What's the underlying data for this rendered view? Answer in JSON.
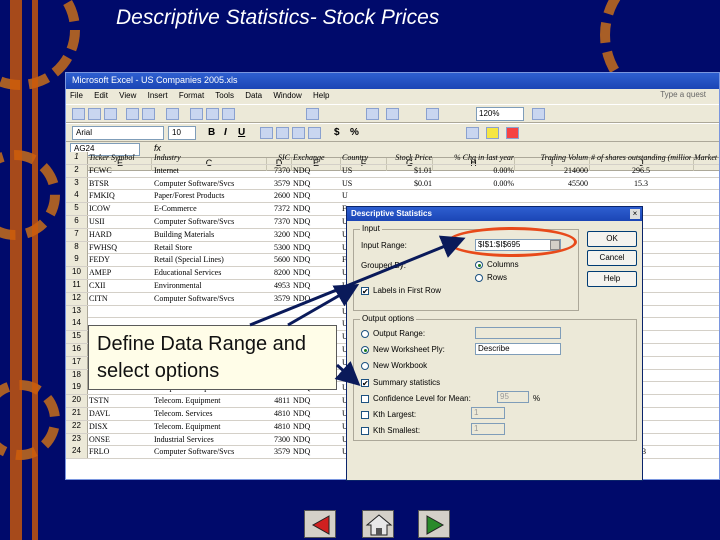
{
  "slide": {
    "title": "Descriptive Statistics- Stock Prices",
    "callout": "Define Data Range and select options"
  },
  "excel": {
    "window_title": "Microsoft Excel - US Companies 2005.xls",
    "menu": [
      "File",
      "Edit",
      "View",
      "Insert",
      "Format",
      "Tools",
      "Data",
      "Window",
      "Help"
    ],
    "help_placeholder": "Type a quest",
    "zoom": "120%",
    "font": "Arial",
    "font_size": "10",
    "name_box": "AG24",
    "fx": "fx",
    "col_headers": [
      "E",
      "C",
      "D",
      "E",
      "F",
      "G",
      "H",
      "I",
      "J"
    ],
    "header_row": {
      "rn": "1",
      "e": "Ticker Symbol",
      "c": "Industry",
      "d": "SIC",
      "e2": "Exchange",
      "f": "Country",
      "g": "Stock Price",
      "h": "% Chg in last year",
      "i": "Trading Volum",
      "j": "# of shares outstanding (millions)",
      "k": "Market"
    },
    "rows": [
      {
        "rn": "2",
        "e": "FCWC",
        "c": "Internet",
        "d": "7370",
        "e2": "NDQ",
        "f": "US",
        "g": "$1.01",
        "h": "0.00%",
        "i": "214000",
        "j": "296.5"
      },
      {
        "rn": "3",
        "e": "BTSR",
        "c": "Computer Software/Svcs",
        "d": "3579",
        "e2": "NDQ",
        "f": "US",
        "g": "$0.01",
        "h": "0.00%",
        "i": "45500",
        "j": "15.3"
      },
      {
        "rn": "4",
        "e": "FMKIQ",
        "c": "Paper/Forest Products",
        "d": "2600",
        "e2": "NDQ",
        "f": "U",
        "g": "",
        "h": "",
        "i": "",
        "j": ""
      },
      {
        "rn": "5",
        "e": "ICOW",
        "c": "E-Commerce",
        "d": "7372",
        "e2": "NDQ",
        "f": "F",
        "g": "",
        "h": "",
        "i": "",
        "j": ""
      },
      {
        "rn": "6",
        "e": "USII",
        "c": "Computer Software/Svcs",
        "d": "7370",
        "e2": "NDQ",
        "f": "U",
        "g": "",
        "h": "",
        "i": "",
        "j": ""
      },
      {
        "rn": "7",
        "e": "HARD",
        "c": "Building Materials",
        "d": "3200",
        "e2": "NDQ",
        "f": "U",
        "g": "",
        "h": "",
        "i": "",
        "j": ""
      },
      {
        "rn": "8",
        "e": "FWHSQ",
        "c": "Retail Store",
        "d": "5300",
        "e2": "NDQ",
        "f": "U",
        "g": "",
        "h": "",
        "i": "",
        "j": ""
      },
      {
        "rn": "9",
        "e": "FEDY",
        "c": "Retail (Special Lines)",
        "d": "5600",
        "e2": "NDQ",
        "f": "F",
        "g": "",
        "h": "",
        "i": "",
        "j": ""
      },
      {
        "rn": "10",
        "e": "AMEP",
        "c": "Educational Services",
        "d": "8200",
        "e2": "NDQ",
        "f": "U",
        "g": "",
        "h": "",
        "i": "",
        "j": ""
      },
      {
        "rn": "11",
        "e": "CXII",
        "c": "Environmental",
        "d": "4953",
        "e2": "NDQ",
        "f": "U",
        "g": "",
        "h": "",
        "i": "",
        "j": ""
      },
      {
        "rn": "12",
        "e": "CITN",
        "c": "Computer Software/Svcs",
        "d": "3579",
        "e2": "NDQ",
        "f": "U",
        "g": "",
        "h": "",
        "i": "",
        "j": ""
      },
      {
        "rn": "13",
        "e": "",
        "c": "",
        "d": "",
        "e2": "",
        "f": "U",
        "g": "",
        "h": "",
        "i": "",
        "j": ""
      },
      {
        "rn": "14",
        "e": "",
        "c": "",
        "d": "",
        "e2": "",
        "f": "U",
        "g": "",
        "h": "",
        "i": "",
        "j": ""
      },
      {
        "rn": "15",
        "e": "",
        "c": "",
        "d": "",
        "e2": "",
        "f": "U",
        "g": "",
        "h": "",
        "i": "",
        "j": ""
      },
      {
        "rn": "16",
        "e": "",
        "c": "",
        "d": "",
        "e2": "",
        "f": "U",
        "g": "",
        "h": "",
        "i": "",
        "j": ""
      },
      {
        "rn": "17",
        "e": "",
        "c": "",
        "d": "",
        "e2": "",
        "f": "U",
        "g": "",
        "h": "",
        "i": "",
        "j": ""
      },
      {
        "rn": "18",
        "e": "MZIO",
        "c": "Biotechnology",
        "d": "2836",
        "e2": "NDQ",
        "f": "U",
        "g": "",
        "h": "",
        "i": "",
        "j": ""
      },
      {
        "rn": "19",
        "e": "PKPT",
        "c": "Computers/Peripherals",
        "d": "3573",
        "e2": "NDQ",
        "f": "U",
        "g": "",
        "h": "",
        "i": "",
        "j": ""
      },
      {
        "rn": "20",
        "e": "TSTN",
        "c": "Telecom. Equipment",
        "d": "4811",
        "e2": "NDQ",
        "f": "U",
        "g": "",
        "h": "",
        "i": "",
        "j": ""
      },
      {
        "rn": "21",
        "e": "DAVL",
        "c": "Telecom. Services",
        "d": "4810",
        "e2": "NDQ",
        "f": "U",
        "g": "",
        "h": "",
        "i": "",
        "j": ""
      },
      {
        "rn": "22",
        "e": "DISX",
        "c": "Telecom. Equipment",
        "d": "4810",
        "e2": "NDQ",
        "f": "U",
        "g": "",
        "h": "",
        "i": "",
        "j": ""
      },
      {
        "rn": "23",
        "e": "ONSE",
        "c": "Industrial Services",
        "d": "7300",
        "e2": "NDQ",
        "f": "U",
        "g": "",
        "h": "",
        "i": "",
        "j": ""
      },
      {
        "rn": "24",
        "e": "FRLO",
        "c": "Computer Software/Svcs",
        "d": "3579",
        "e2": "NDQ",
        "f": "US",
        "g": "$0.01",
        "h": "0.00%",
        "i": "25000",
        "j": "7.3"
      }
    ]
  },
  "dialog": {
    "title": "Descriptive Statistics",
    "close": "×",
    "input_group": "Input",
    "input_range_label": "Input Range:",
    "input_range_value": "$I$1:$I$695",
    "grouped_by_label": "Grouped By:",
    "columns": "Columns",
    "rows": "Rows",
    "labels_first_row": "Labels in First Row",
    "ok": "OK",
    "cancel": "Cancel",
    "help": "Help",
    "output_group": "Output options",
    "output_range": "Output Range:",
    "new_worksheet": "New Worksheet Ply:",
    "new_worksheet_value": "Describe",
    "new_workbook": "New Workbook",
    "summary_statistics": "Summary statistics",
    "confidence_level": "Confidence Level for Mean:",
    "confidence_value": "95",
    "percent": "%",
    "kth_largest": "Kth Largest:",
    "kth_largest_value": "1",
    "kth_smallest": "Kth Smallest:",
    "kth_smallest_value": "1",
    "check_mark": "✔"
  },
  "colors": {
    "background": "#000a6b",
    "accent_orange": "#e07a10",
    "highlight_oval": "#e84a1a"
  }
}
